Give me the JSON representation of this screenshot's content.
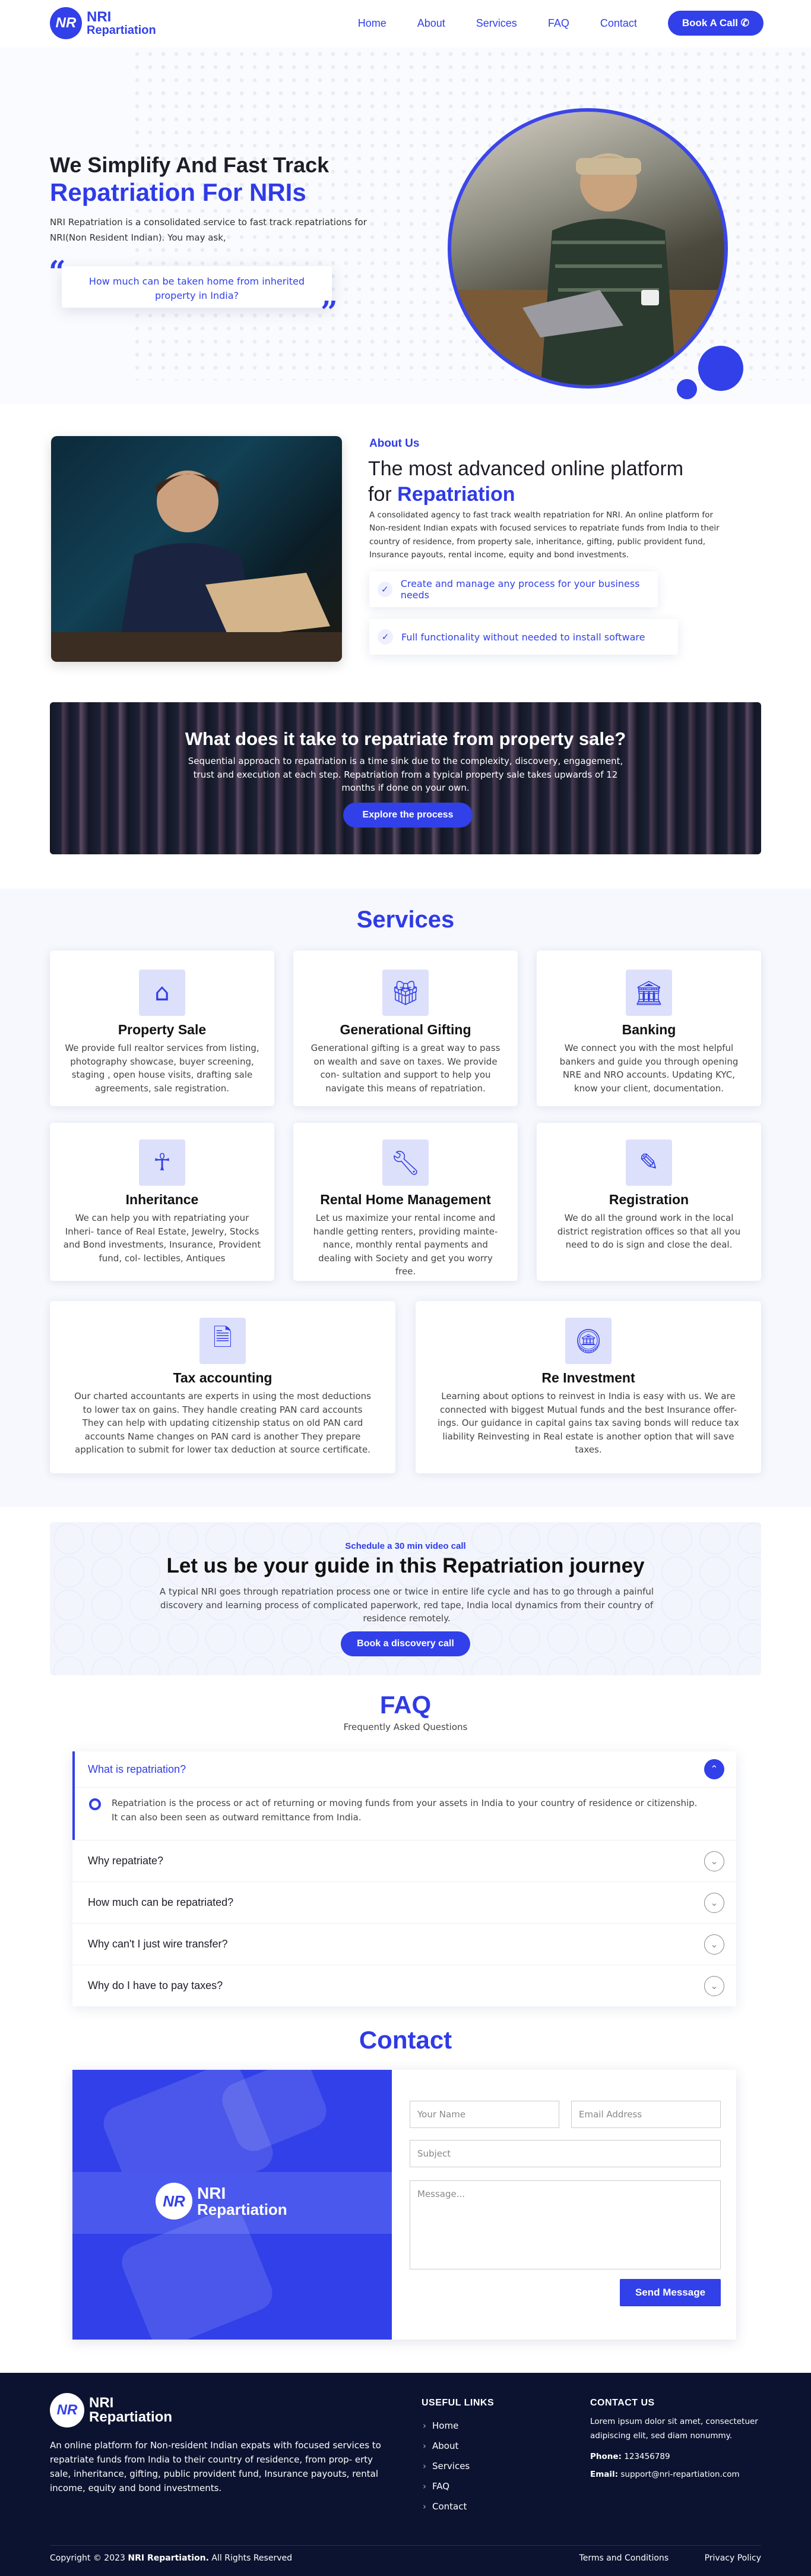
{
  "brand": {
    "mark": "NR",
    "line1": "NRI",
    "line2": "Repartiation"
  },
  "nav": {
    "items": [
      "Home",
      "About",
      "Services",
      "FAQ",
      "Contact"
    ],
    "cta": "Book A Call",
    "cta_icon": "phone-icon"
  },
  "hero": {
    "title_line1": "We Simplify And Fast Track",
    "title_line2": "Repatriation For NRIs",
    "intro": "NRI Repatriation is a consolidated service to fast track repatriations for NRI(Non Resident Indian). You may ask,",
    "quote": "How much can be taken home from inherited property in India?"
  },
  "about": {
    "tag": "About Us",
    "heading_plain": "The most advanced online platform for",
    "heading_accent": "Repatriation",
    "body": "A consolidated agency to fast track wealth repatriation for NRI. An online platform for Non-resident Indian expats with focused services to  repatriate funds from India to their country of residence, from property sale, inheritance, gifting, public provident fund, Insurance payouts, rental income, equity and bond investments.",
    "features": [
      "Create and manage any process for your business needs",
      "Full functionality without needed to install software"
    ]
  },
  "banner": {
    "title": "What does it take to repatriate from property sale?",
    "text": "Sequential approach to repatriation is a time sink due to the complexity, discovery, engagement, trust and execution at each step. Repatriation from a typical property sale takes upwards of 12 months if done on your own.",
    "button": "Explore the process"
  },
  "services": {
    "title": "Services",
    "cards": [
      {
        "icon": "home-icon",
        "title": "Property Sale",
        "text": "We provide full realtor services from listing, photography showcase, buyer screening, staging , open house visits, drafting sale agreements, sale registration."
      },
      {
        "icon": "gift-icon",
        "title": "Generational Gifting",
        "text": "Generational gifting is a great way to pass on wealth and save on taxes. We provide con- sultation and support to help you  navigate this means of repatriation."
      },
      {
        "icon": "bank-icon",
        "title": "Banking",
        "text": "We connect you with the most helpful bankers and guide you through opening NRE and NRO accounts.  Updating KYC, know your client, documentation."
      },
      {
        "icon": "person-icon",
        "title": "Inheritance",
        "text": "We can help you with repatriating your Inheri- tance of Real Estate, Jewelry, Stocks and Bond investments, Insurance, Provident fund, col- lectibles, Antiques"
      },
      {
        "icon": "wrench-icon",
        "title": "Rental Home Management",
        "text": "Let us maximize your rental income and handle getting renters, providing mainte- nance, monthly rental payments and dealing with Society and get you worry free."
      },
      {
        "icon": "registration-icon",
        "title": "Registration",
        "text": "We do all the ground work in the local district registration offices so that all you need to do is sign and close the deal."
      },
      {
        "icon": "tax-icon",
        "title": "Tax accounting",
        "text": "Our charted accountants are experts in using the most deductions to lower tax on gains. They handle creating PAN card accounts They can help with updating citizenship status on old PAN card accounts Name changes on PAN card is another  They prepare application to submit for lower tax deduction at source certificate."
      },
      {
        "icon": "coins-icon",
        "title": "Re Investment",
        "text": "Learning about options to reinvest in India is easy with us. We are connected with biggest Mutual funds and the best Insurance offer- ings. Our guidance in capital gains tax saving bonds will reduce tax liability Reinvesting in Real estate is another option that will save taxes."
      }
    ]
  },
  "cta": {
    "small": "Schedule a 30 min video call",
    "title": "Let us be your guide in this  Repatriation journey",
    "text": "A typical NRI goes through repatriation process one or twice in entire life cycle and has to go through a painful discovery and learning process of complicated paperwork, red tape, India local dynamics from their country of residence remotely.",
    "button": "Book a discovery call"
  },
  "faq": {
    "title": "FAQ",
    "subtitle": "Frequently Asked Questions",
    "open": {
      "q": "What is repatriation?",
      "a": "Repatriation is the process or act of returning or moving funds from your assets in India to your country of residence or citizenship. It can also been seen as outward remittance from India."
    },
    "closed": [
      "Why repatriate?",
      "How much can be repatriated?",
      "Why can't I just wire transfer?",
      "Why do I have to pay taxes?"
    ]
  },
  "contact": {
    "title": "Contact",
    "name_ph": "Your Name",
    "email_ph": "Email Address",
    "subject_ph": "Subject",
    "message_ph": "Message...",
    "send": "Send Message"
  },
  "footer": {
    "desc": "An online platform for Non-resident Indian expats with focused services to  repatriate funds from India to their country of residence, from prop- erty sale, inheritance, gifting, public provident fund, Insurance payouts, rental income, equity and bond investments.",
    "links_title": "USEFUL LINKS",
    "links": [
      "Home",
      "About",
      "Services",
      "FAQ",
      "Contact"
    ],
    "contact_title": "CONTACT US",
    "contact_text": "Lorem ipsum dolor sit amet, consectetuer adipiscing elit, sed diam nonummy.",
    "phone_label": "Phone:",
    "phone": "123456789",
    "email_label": "Email:",
    "email": "support@nri-repartiation.com",
    "copy_prefix": "Copyright © 2023",
    "copy_brand": "NRI Repartiation.",
    "copy_suffix": "All Rights Reserved",
    "terms": "Terms and Conditions",
    "privacy": "Privacy Policy"
  }
}
